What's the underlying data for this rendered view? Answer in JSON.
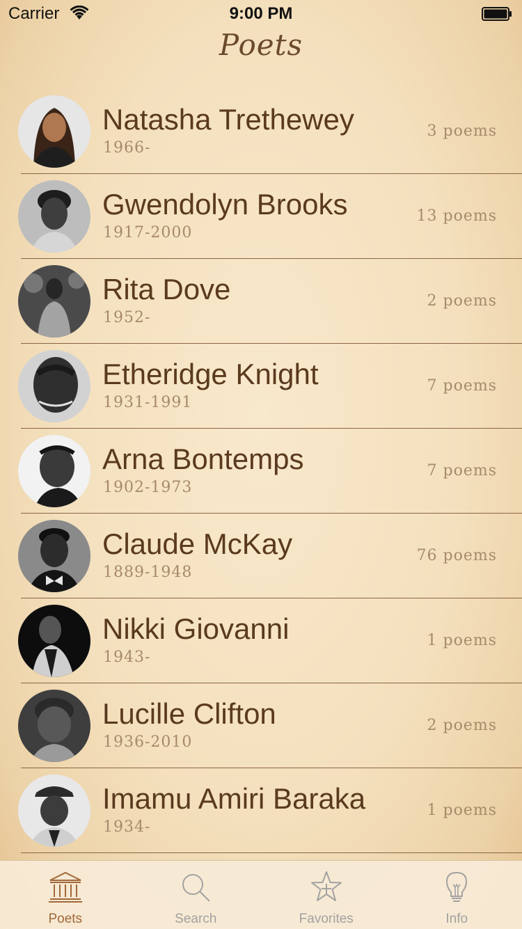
{
  "status_bar": {
    "carrier": "Carrier",
    "time": "9:00 PM"
  },
  "nav": {
    "title": "Poets"
  },
  "poets": [
    {
      "name": "Natasha Trethewey",
      "dates": "1966-",
      "poems": "3 poems"
    },
    {
      "name": "Gwendolyn Brooks",
      "dates": "1917-2000",
      "poems": "13 poems"
    },
    {
      "name": "Rita Dove",
      "dates": "1952-",
      "poems": "2 poems"
    },
    {
      "name": "Etheridge Knight",
      "dates": "1931-1991",
      "poems": "7 poems"
    },
    {
      "name": "Arna Bontemps",
      "dates": "1902-1973",
      "poems": "7 poems"
    },
    {
      "name": "Claude McKay",
      "dates": "1889-1948",
      "poems": "76 poems"
    },
    {
      "name": "Nikki Giovanni",
      "dates": "1943-",
      "poems": "1 poems"
    },
    {
      "name": "Lucille Clifton",
      "dates": "1936-2010",
      "poems": "2 poems"
    },
    {
      "name": "Imamu Amiri Baraka",
      "dates": "1934-",
      "poems": "1 poems"
    }
  ],
  "tabs": [
    {
      "label": "Poets",
      "icon": "building-columns-icon",
      "selected": true
    },
    {
      "label": "Search",
      "icon": "magnifier-icon",
      "selected": false
    },
    {
      "label": "Favorites",
      "icon": "star-icon",
      "selected": false
    },
    {
      "label": "Info",
      "icon": "lightbulb-icon",
      "selected": false
    }
  ],
  "colors": {
    "accent": "#a1693a",
    "title": "#6b4a2b",
    "secondary_text": "#a68a6b",
    "inactive_tab": "#a2a2a2"
  }
}
